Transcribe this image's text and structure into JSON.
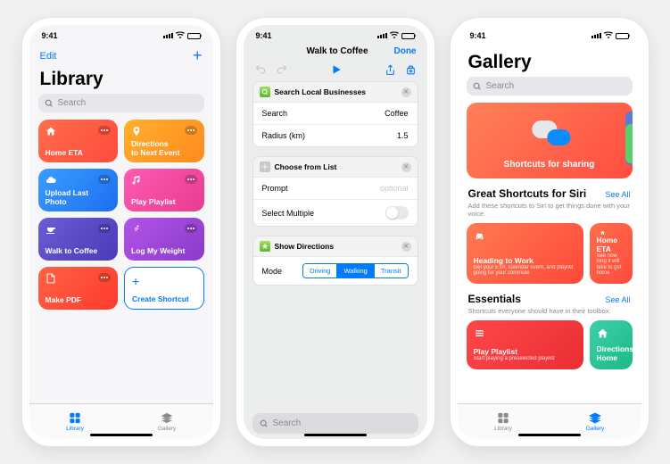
{
  "status": {
    "time": "9:41"
  },
  "library": {
    "edit": "Edit",
    "title": "Library",
    "search_placeholder": "Search",
    "tiles": [
      {
        "name": "Home ETA",
        "gradient": "linear-gradient(135deg,#ff6e4a,#ff4a3d)",
        "icon": "home"
      },
      {
        "name": "Directions\nto Next Event",
        "gradient": "linear-gradient(135deg,#ffb02e,#ff8a1e)",
        "icon": "pin"
      },
      {
        "name": "Upload Last Photo",
        "gradient": "linear-gradient(135deg,#3a9eff,#1d6ef0)",
        "icon": "cloud"
      },
      {
        "name": "Play Playlist",
        "gradient": "linear-gradient(135deg,#ff5ab3,#e83c8f)",
        "icon": "music"
      },
      {
        "name": "Walk to Coffee",
        "gradient": "linear-gradient(135deg,#6b5dd3,#4a3bb8)",
        "icon": "coffee"
      },
      {
        "name": "Log My Weight",
        "gradient": "linear-gradient(135deg,#b253e8,#8a3bc8)",
        "icon": "running"
      },
      {
        "name": "Make PDF",
        "gradient": "linear-gradient(135deg,#ff6244,#ff3a2e)",
        "icon": "doc"
      }
    ],
    "create": "Create Shortcut",
    "tab_library": "Library",
    "tab_gallery": "Gallery"
  },
  "detail": {
    "title": "Walk to Coffee",
    "done": "Done",
    "blocks": [
      {
        "title": "Search Local Businesses",
        "icon_bg": "linear-gradient(#a0e05a,#5ab82e)",
        "rows": [
          {
            "label": "Search",
            "value": "Coffee"
          },
          {
            "label": "Radius (km)",
            "value": "1.5"
          }
        ]
      },
      {
        "title": "Choose from List",
        "icon_bg": "#b8b8b8",
        "rows": [
          {
            "label": "Prompt",
            "value": "optional",
            "style": "placeholder"
          },
          {
            "label": "Select Multiple",
            "toggle": true
          }
        ]
      },
      {
        "title": "Show Directions",
        "icon_bg": "linear-gradient(#a0e05a,#5ab82e)",
        "mode_row": {
          "label": "Mode",
          "options": [
            "Driving",
            "Walking",
            "Transit"
          ],
          "selected": "Walking"
        }
      }
    ],
    "search_placeholder": "Search"
  },
  "gallery": {
    "title": "Gallery",
    "search_placeholder": "Search",
    "hero_title": "Shortcuts for sharing",
    "sections": [
      {
        "title": "Great Shortcuts for Siri",
        "see_all": "See All",
        "sub": "Add these shortcuts to Siri to get things done with your voice.",
        "cards": [
          {
            "name": "Heading to Work",
            "desc": "Get your ETA, calendar event, and playlist going for your commute",
            "gradient": "linear-gradient(135deg,#ff7a52,#ff4838)",
            "icon": "car"
          },
          {
            "name": "Home ETA",
            "desc": "See how long it will take to get home",
            "gradient": "linear-gradient(135deg,#ff6e4a,#ff4a3d)",
            "icon": "home"
          }
        ]
      },
      {
        "title": "Essentials",
        "see_all": "See All",
        "sub": "Shortcuts everyone should have in their toolbox.",
        "cards": [
          {
            "name": "Play Playlist",
            "desc": "Start playing a preselected playlist",
            "gradient": "linear-gradient(135deg,#ff474a,#e82e32)",
            "icon": "list"
          },
          {
            "name": "Directions Home",
            "desc": "",
            "gradient": "linear-gradient(135deg,#3ed0a8,#1db888)",
            "icon": "home"
          }
        ]
      }
    ]
  }
}
